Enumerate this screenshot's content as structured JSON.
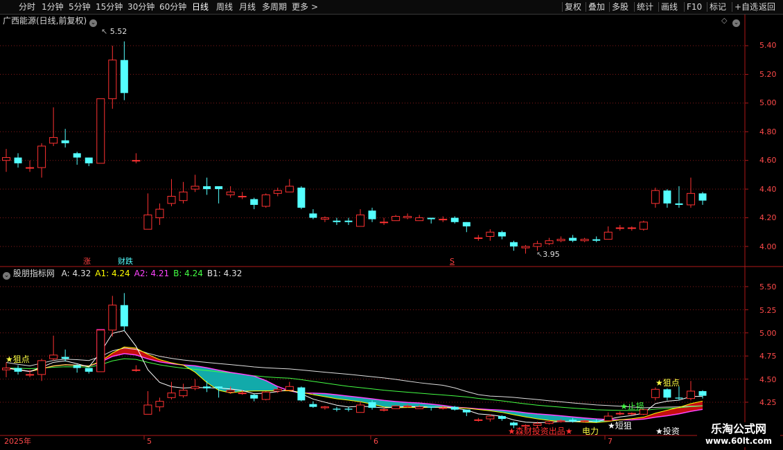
{
  "toolbar": {
    "periods": [
      "分时",
      "1分钟",
      "5分钟",
      "15分钟",
      "30分钟",
      "60分钟",
      "日线",
      "周线",
      "月线",
      "多周期",
      "更多"
    ],
    "active_period": "日线",
    "more_arrow": ">",
    "tools": [
      "复权",
      "叠加",
      "多股",
      "统计",
      "画线",
      "F10",
      "标记",
      "+自选",
      "返回"
    ]
  },
  "main_chart": {
    "title": "广西能源(日线,前复权)",
    "high_label": "5.52",
    "low_label": "3.95",
    "y_ticks": [
      "5.40",
      "5.20",
      "5.00",
      "4.80",
      "4.60",
      "4.40",
      "4.20",
      "4.00"
    ],
    "markers": {
      "zhang": "涨",
      "caidie": "财跌",
      "s": "S"
    },
    "corner_icons": [
      "diamond-icon",
      "settings-icon"
    ]
  },
  "indicator": {
    "name": "股朋指标网",
    "values": [
      {
        "label": "A:",
        "value": "4.32",
        "color": "#e0e0e0"
      },
      {
        "label": "A1:",
        "value": "4.24",
        "color": "#ffff00"
      },
      {
        "label": "A2:",
        "value": "4.21",
        "color": "#ff44ff"
      },
      {
        "label": "B:",
        "value": "4.24",
        "color": "#44ff44"
      },
      {
        "label": "B1:",
        "value": "4.32",
        "color": "#e0e0e0"
      }
    ],
    "y_ticks": [
      "5.50",
      "5.25",
      "5.00",
      "4.75",
      "4.50",
      "4.25"
    ],
    "signals": {
      "zhudian_left": "★狙点",
      "zhudian_right": "★狙点",
      "zhiyu": "★止损",
      "duanzhu": "★短狙",
      "touzi": "★投资",
      "bottom_red": "★森财投资出品★",
      "dianli": "电力"
    }
  },
  "x_axis": {
    "labels": [
      "2025年",
      "5",
      "6",
      "7"
    ]
  },
  "watermark": {
    "title": "乐淘公式网",
    "url": "www.60lt.com"
  },
  "colors": {
    "up": "#ff3232",
    "down": "#54ffff",
    "axis": "#b01818",
    "grid": "#8a1a1a"
  },
  "chart_data": {
    "type": "candlestick",
    "title": "广西能源(日线,前复权)",
    "ylim": [
      3.9,
      5.6
    ],
    "candles": [
      [
        4.6,
        4.62,
        4.68,
        4.52
      ],
      [
        4.62,
        4.58,
        4.65,
        4.55
      ],
      [
        4.55,
        4.55,
        4.6,
        4.52
      ],
      [
        4.55,
        4.7,
        4.72,
        4.48
      ],
      [
        4.72,
        4.76,
        4.97,
        4.7
      ],
      [
        4.74,
        4.72,
        4.82,
        4.69
      ],
      [
        4.65,
        4.62,
        4.66,
        4.57
      ],
      [
        4.62,
        4.58,
        4.62,
        4.56
      ],
      [
        4.58,
        5.03,
        5.03,
        4.58
      ],
      [
        5.03,
        5.3,
        5.4,
        4.96
      ],
      [
        5.3,
        5.07,
        5.43,
        5.02
      ],
      [
        4.6,
        4.6,
        4.65,
        4.58
      ],
      [
        4.12,
        4.22,
        4.37,
        4.12
      ],
      [
        4.2,
        4.26,
        4.3,
        4.15
      ],
      [
        4.3,
        4.35,
        4.47,
        4.28
      ],
      [
        4.32,
        4.38,
        4.45,
        4.3
      ],
      [
        4.4,
        4.42,
        4.5,
        4.38
      ],
      [
        4.42,
        4.4,
        4.48,
        4.36
      ],
      [
        4.42,
        4.4,
        4.42,
        4.3
      ],
      [
        4.36,
        4.38,
        4.42,
        4.34
      ],
      [
        4.35,
        4.35,
        4.38,
        4.33
      ],
      [
        4.33,
        4.29,
        4.34,
        4.26
      ],
      [
        4.28,
        4.36,
        4.37,
        4.27
      ],
      [
        4.37,
        4.39,
        4.41,
        4.35
      ],
      [
        4.38,
        4.42,
        4.47,
        4.38
      ],
      [
        4.41,
        4.27,
        4.42,
        4.26
      ],
      [
        4.23,
        4.2,
        4.26,
        4.19
      ],
      [
        4.19,
        4.2,
        4.21,
        4.17
      ],
      [
        4.18,
        4.17,
        4.2,
        4.15
      ],
      [
        4.18,
        4.17,
        4.2,
        4.15
      ],
      [
        4.14,
        4.22,
        4.26,
        4.14
      ],
      [
        4.25,
        4.19,
        4.27,
        4.17
      ],
      [
        4.17,
        4.17,
        4.2,
        4.15
      ],
      [
        4.18,
        4.21,
        4.22,
        4.18
      ],
      [
        4.2,
        4.21,
        4.23,
        4.19
      ],
      [
        4.18,
        4.2,
        4.22,
        4.18
      ],
      [
        4.2,
        4.19,
        4.2,
        4.16
      ],
      [
        4.19,
        4.19,
        4.21,
        4.17
      ],
      [
        4.2,
        4.17,
        4.21,
        4.16
      ],
      [
        4.17,
        4.14,
        4.17,
        4.1
      ],
      [
        4.06,
        4.06,
        4.08,
        4.04
      ],
      [
        4.07,
        4.1,
        4.12,
        4.04
      ],
      [
        4.1,
        4.07,
        4.11,
        4.05
      ],
      [
        4.03,
        4.0,
        4.04,
        3.97
      ],
      [
        3.99,
        4.0,
        4.01,
        3.95
      ],
      [
        4.0,
        4.02,
        4.04,
        3.97
      ],
      [
        4.02,
        4.04,
        4.06,
        4.01
      ],
      [
        4.04,
        4.05,
        4.07,
        4.03
      ],
      [
        4.06,
        4.04,
        4.08,
        4.03
      ],
      [
        4.04,
        4.05,
        4.06,
        4.03
      ],
      [
        4.05,
        4.04,
        4.07,
        4.03
      ],
      [
        4.05,
        4.1,
        4.14,
        4.05
      ],
      [
        4.13,
        4.13,
        4.15,
        4.11
      ],
      [
        4.13,
        4.13,
        4.14,
        4.11
      ],
      [
        4.12,
        4.17,
        4.18,
        4.11
      ],
      [
        4.3,
        4.39,
        4.41,
        4.27
      ],
      [
        4.39,
        4.3,
        4.4,
        4.27
      ],
      [
        4.3,
        4.29,
        4.42,
        4.27
      ],
      [
        4.29,
        4.37,
        4.48,
        4.27
      ],
      [
        4.37,
        4.32,
        4.38,
        4.29
      ]
    ]
  }
}
